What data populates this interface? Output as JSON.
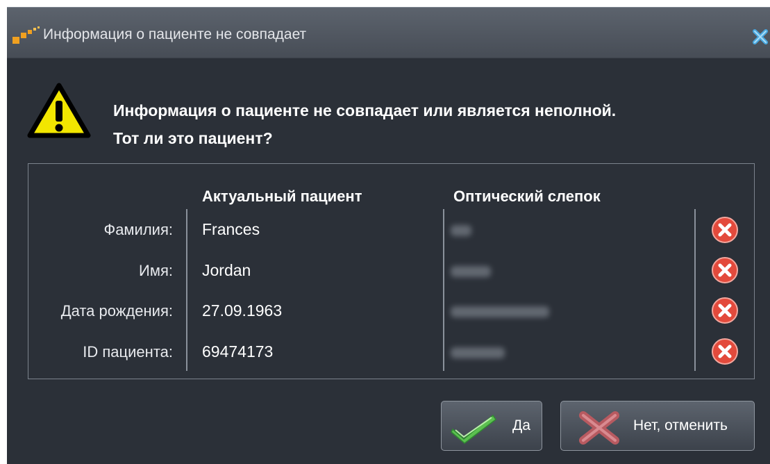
{
  "window": {
    "title": "Информация о пациенте не совпадает"
  },
  "message": {
    "line1": "Информация о пациенте не совпадает или является неполной.",
    "line2": "Тот ли это пациент?"
  },
  "table": {
    "headers": {
      "current": "Актуальный пациент",
      "optical": "Оптический слепок"
    },
    "rows": [
      {
        "label": "Фамилия:",
        "current": "Frances",
        "match": false
      },
      {
        "label": "Имя:",
        "current": "Jordan",
        "match": false
      },
      {
        "label": "Дата рождения:",
        "current": "27.09.1963",
        "match": false
      },
      {
        "label": "ID пациента:",
        "current": "69474173",
        "match": false
      }
    ]
  },
  "buttons": {
    "yes": "Да",
    "no": "Нет, отменить"
  },
  "colors": {
    "background": "#2b3038",
    "warning_yellow": "#f2e600",
    "error_red": "#e34a3c",
    "accent_orange": "#f0a020",
    "close_blue": "#4aa8e0",
    "check_green": "#5cc050"
  }
}
